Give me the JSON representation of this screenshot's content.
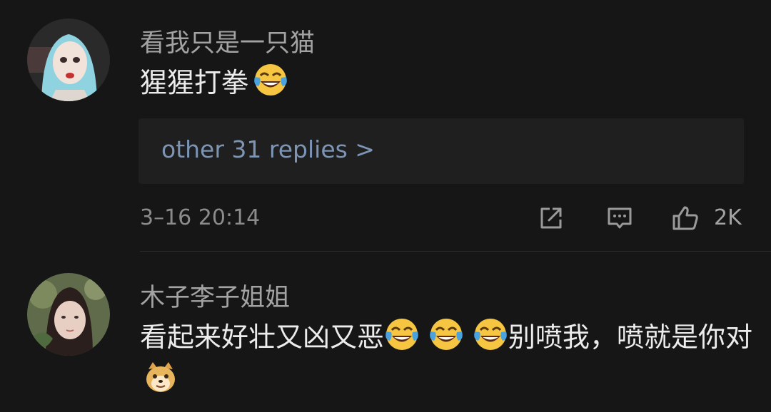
{
  "comments": [
    {
      "username": "看我只是一只猫",
      "text": "猩猩打拳",
      "emoji": "face-with-tears-of-joy",
      "replies_label": "other 31 replies >",
      "timestamp": "3–16 20:14",
      "like_count": "2K",
      "icons": [
        "share-icon",
        "comment-icon",
        "like-icon"
      ]
    },
    {
      "username": "木子李子姐姐",
      "text_parts": [
        "看起来好壮又凶又恶",
        "别喷我，喷就是你对"
      ],
      "emojis": [
        "face-with-tears-of-joy",
        "face-with-tears-of-joy",
        "face-with-tears-of-joy",
        "doge"
      ]
    }
  ],
  "colors": {
    "background": "#161616",
    "username": "#a3a3a3",
    "text": "#ececec",
    "link": "#7d95b5",
    "meta": "#8b8b8b",
    "reply_box": "#1f1f1f"
  }
}
